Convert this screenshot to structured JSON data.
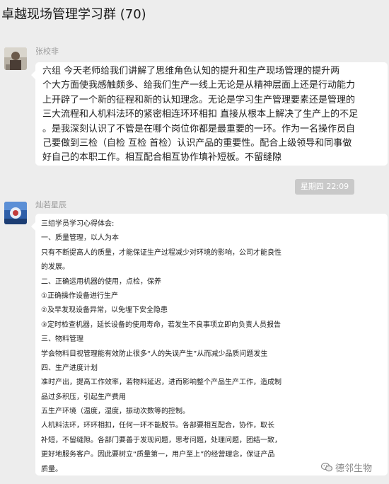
{
  "chat": {
    "title": "卓越现场管理学习群 (70)",
    "time_divider": "星期四 22:09"
  },
  "messages": [
    {
      "sender": "张校非",
      "avatar_icon": "user-avatar-photo-icon",
      "lines": [
        "六组        今天老师给我们讲解了思维角色认知的提升和生产现场管理的提升两",
        "个大方面使我感触颇多、给我们生产一线上无论是从精神层面上还是行动能力",
        "上开辟了一个新的征程和新的认知理念。无论是学习生产管理要素还是管理的",
        "三大流程和人机料法环的紧密相连环环相扣 直接从根本上解决了生产上的不足",
        "。是我深刻认识了不管是在哪个岗位你都是最重要的一环。作为一名操作员自",
        "己要做到三检（自检  互检  首检）认识产品的重要性。配合上级领导和同事做",
        "好自己的本职工作。相互配合相互协作填补短板。不留缝隙"
      ]
    },
    {
      "sender": "灿若星辰",
      "avatar_icon": "user-avatar-photo-icon",
      "lines": [
        "三组学员学习心得体会:",
        "一、质量管理，以人为本",
        "只有不断提高人的质量，才能保证生产过程减少对环境的影响，公司才能良性",
        "的发展。",
        "二、正确运用机器的使用，点检，保养",
        "①正确操作设备进行生产",
        "②及早发现设备异常，以免埋下安全隐患",
        "③定时检查机器，延长设备的使用寿命，若发生不良事项立即向负责人员报告",
        "三、物料管理",
        "学会物料目视管理能有效防止很多“人的失误产生”从而减少品质问题发生",
        "四、生产进度计划",
        "准时产出，提高工作效率，若物料延迟，进而影响整个产品生产工作，造成制",
        "品过多积压，引起生产费用",
        "五生产环境（温度，湿度，振动次数等的控制。",
        "人机料法环，环环相扣，任何一环不能脱节。各部要相互配合，协作，取长",
        "补短，不留缝隙。各部门要善于发现问题，思考问题，处理问题，团结一致，",
        "更好地服务客户。因此要树立“质量第一，用户至上”的经营理念，保证产品",
        "质量。"
      ]
    }
  ],
  "watermark": {
    "text": "德邻生物",
    "icon": "wechat-official-account-icon"
  }
}
